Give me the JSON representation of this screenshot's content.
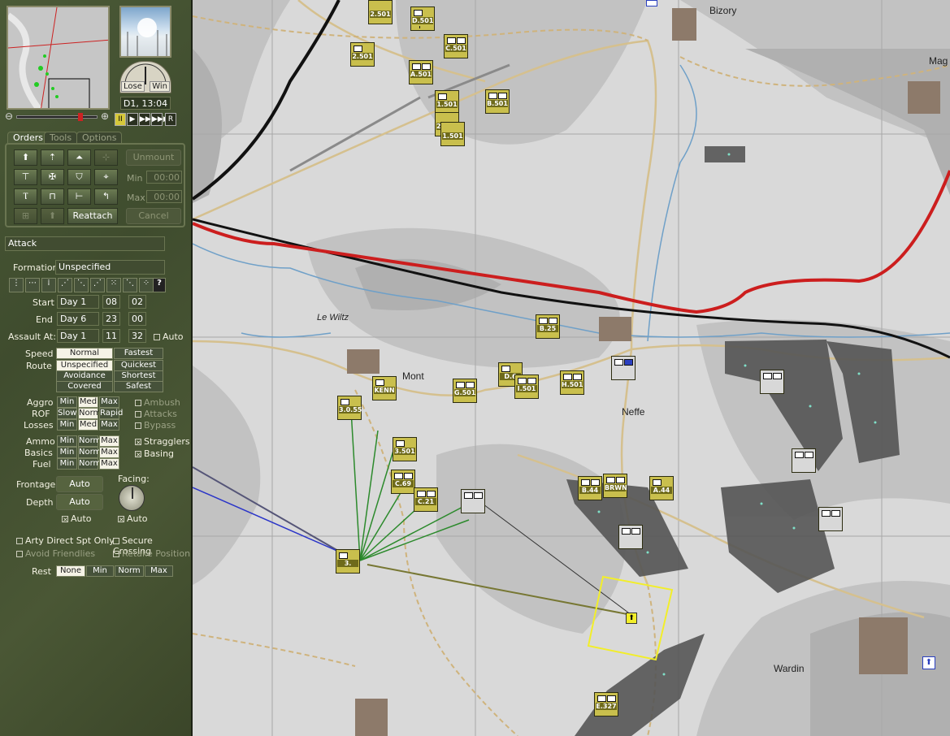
{
  "panel": {
    "gauge": {
      "lose": "Lose",
      "win": "Win"
    },
    "time_display": "D1, 13:04",
    "playback": [
      "II",
      "▶",
      "▶▶",
      "▶▶▶",
      "R"
    ],
    "tabs": [
      "Orders",
      "Tools",
      "Options"
    ],
    "orders": {
      "unmount_label": "Unmount",
      "min_label": "Min",
      "min_value": "00:00",
      "max_label": "Max",
      "max_value": "00:00",
      "reattach_label": "Reattach",
      "cancel_label": "Cancel"
    },
    "current_order": "Attack",
    "formation_label": "Formation",
    "formation_value": "Unspecified",
    "start": {
      "label": "Start",
      "day": "Day 1",
      "hh": "08",
      "mm": "02"
    },
    "end": {
      "label": "End",
      "day": "Day 6",
      "hh": "23",
      "mm": "00"
    },
    "assault": {
      "label": "Assault At:",
      "day": "Day 1",
      "hh": "11",
      "mm": "32",
      "auto": "Auto"
    },
    "speed": {
      "label": "Speed",
      "options": [
        "Normal",
        "Fastest"
      ],
      "selected": "Normal"
    },
    "route": {
      "label": "Route",
      "options": [
        "Unspecified",
        "Quickest",
        "Avoidance",
        "Shortest",
        "Covered",
        "Safest"
      ],
      "selected": "Unspecified"
    },
    "aggro": {
      "label": "Aggro",
      "options": [
        "Min",
        "Med",
        "Max"
      ]
    },
    "rof": {
      "label": "ROF",
      "options": [
        "Slow",
        "Norm",
        "Rapid"
      ]
    },
    "losses": {
      "label": "Losses",
      "options": [
        "Min",
        "Med",
        "Max"
      ]
    },
    "ammo": {
      "label": "Ammo",
      "options": [
        "Min",
        "Norm",
        "Max"
      ]
    },
    "basics": {
      "label": "Basics",
      "options": [
        "Min",
        "Norm",
        "Max"
      ]
    },
    "fuel": {
      "label": "Fuel",
      "options": [
        "Min",
        "Norm",
        "Max"
      ]
    },
    "checks_right": [
      "Ambush",
      "Attacks",
      "Bypass",
      "Stragglers",
      "Basing"
    ],
    "frontage": {
      "label": "Frontage",
      "value": "Auto",
      "auto": "Auto"
    },
    "depth": {
      "label": "Depth",
      "value": "Auto"
    },
    "facing": {
      "label": "Facing:",
      "auto": "Auto"
    },
    "arty": "Arty Direct Spt Only",
    "secure": "Secure Crossing",
    "avoid": "Avoid Friendlies",
    "retake": "Retake Position",
    "rest": {
      "label": "Rest",
      "options": [
        "None",
        "Min",
        "Norm",
        "Max"
      ],
      "selected": "None"
    }
  },
  "map": {
    "towns": [
      "Bizory",
      "Mag",
      "Le Wiltz",
      "Mont",
      "Neffe",
      "Wardin"
    ],
    "units": [
      "2.501",
      "D.501",
      "2.501",
      "C.501",
      "A.501",
      "1.501",
      "B.501",
      "2B.705",
      "1.501",
      "B.25",
      "KENN",
      "G.501",
      "D.6",
      "I.501",
      "H.501",
      "3.0.55",
      "3.501",
      "C.69",
      "C.21",
      "B.44",
      "BRWN",
      "A.44",
      "E.327",
      "3."
    ]
  }
}
